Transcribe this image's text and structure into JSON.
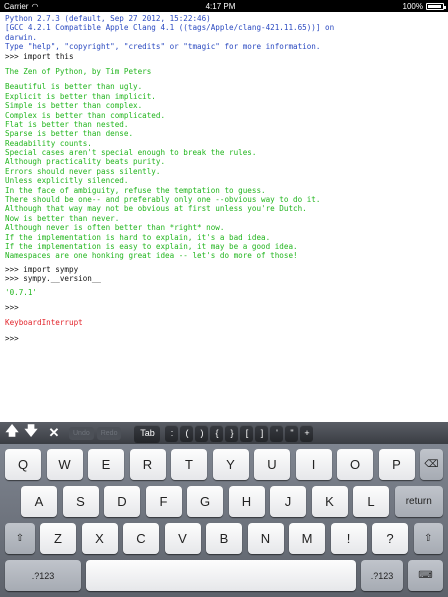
{
  "status_bar": {
    "carrier": "Carrier",
    "time": "4:17 PM",
    "battery": "100%"
  },
  "console": {
    "banner": [
      "Python 2.7.3 (default, Sep 27 2012, 15:22:46)",
      "[GCC 4.2.1 Compatible Apple Clang 4.1 ((tags/Apple/clang-421.11.65))] on",
      "darwin.",
      "Type \"help\", \"copyright\", \"credits\" or \"tmagic\" for more information."
    ],
    "cmd1": ">>> import this",
    "zen_title": "The Zen of Python, by Tim Peters",
    "zen_lines": [
      "Beautiful is better than ugly.",
      "Explicit is better than implicit.",
      "Simple is better than complex.",
      "Complex is better than complicated.",
      "Flat is better than nested.",
      "Sparse is better than dense.",
      "Readability counts.",
      "Special cases aren't special enough to break the rules.",
      "Although practicality beats purity.",
      "Errors should never pass silently.",
      "Unless explicitly silenced.",
      "In the face of ambiguity, refuse the temptation to guess.",
      "There should be one-- and preferably only one --obvious way to do it.",
      "Although that way may not be obvious at first unless you're Dutch.",
      "Now is better than never.",
      "Although never is often better than *right* now.",
      "If the implementation is hard to explain, it's a bad idea.",
      "If the implementation is easy to explain, it may be a good idea.",
      "Namespaces are one honking great idea -- let's do more of those!"
    ],
    "cmd2": ">>> import sympy",
    "cmd3": ">>> sympy.__version__",
    "version_out": "'0.7.1'",
    "prompt_a": ">>>",
    "interrupt": "KeyboardInterrupt",
    "prompt_b": ">>>"
  },
  "accessory_bar": {
    "up_icon": "up-arrow-icon",
    "down_icon": "down-arrow-icon",
    "close_icon": "close-icon",
    "ghost_keys": [
      "Undo",
      "Redo"
    ],
    "tab": "Tab",
    "symbols": [
      ":",
      "(",
      ")",
      "{",
      "}",
      "[",
      "]",
      "'",
      "\"",
      "+"
    ],
    "dots_label": "..."
  },
  "keyboard": {
    "row1": [
      "Q",
      "W",
      "E",
      "R",
      "T",
      "Y",
      "U",
      "I",
      "O",
      "P"
    ],
    "backspace": "⌫",
    "row2": [
      "A",
      "S",
      "D",
      "F",
      "G",
      "H",
      "J",
      "K",
      "L"
    ],
    "return": "return",
    "row3": [
      "Z",
      "X",
      "C",
      "V",
      "B",
      "N",
      "M",
      "!",
      "?"
    ],
    "row3_sub": [
      "",
      "",
      "",
      "",
      "",
      "",
      "",
      ",",
      "."
    ],
    "shift": "⇧",
    "numbers": ".?123",
    "hide": "⌨"
  }
}
